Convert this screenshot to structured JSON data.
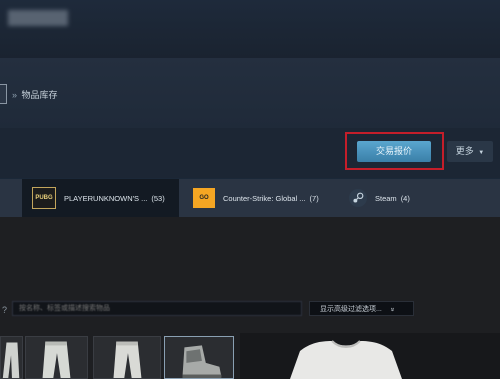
{
  "breadcrumb": {
    "separator": "»",
    "current": "物品库存"
  },
  "actions": {
    "trade_offer": "交易报价",
    "more": "更多"
  },
  "tabs": [
    {
      "icon_text": "PUBG",
      "label": "PLAYERUNKNOWN'S ...",
      "count": "(53)",
      "icon": "pubg-icon"
    },
    {
      "icon_text": "GO",
      "label": "Counter-Strike: Global ...",
      "count": "(7)",
      "icon": "csgo-icon"
    },
    {
      "icon_text": "",
      "label": "Steam",
      "count": "(4)",
      "icon": "steam-icon"
    }
  ],
  "filter": {
    "help": "?",
    "placeholder": "按名称、标签或描述搜索物品",
    "advanced": "显示高级过滤选项...",
    "advanced_chevron": "»"
  },
  "colors": {
    "accent": "#4a93bd",
    "highlight": "#c41e2a",
    "background": "#1b2838"
  },
  "items": [
    {
      "icon": "pants-icon"
    },
    {
      "icon": "pants-icon"
    },
    {
      "icon": "pants-icon"
    },
    {
      "icon": "boots-icon"
    }
  ]
}
